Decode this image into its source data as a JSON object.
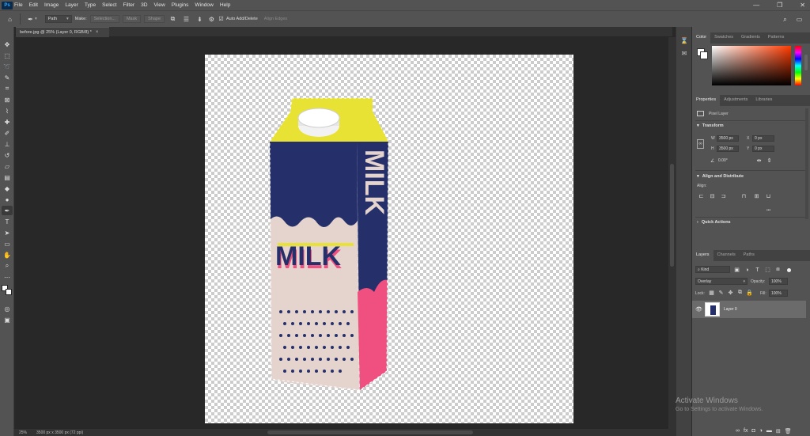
{
  "menubar": {
    "logo": "Ps",
    "menus": [
      "File",
      "Edit",
      "Image",
      "Layer",
      "Type",
      "Select",
      "Filter",
      "3D",
      "View",
      "Plugins",
      "Window",
      "Help"
    ],
    "window_controls": [
      "—",
      "❐",
      "✕"
    ]
  },
  "options": {
    "mode_value": "Path",
    "make_label": "Make:",
    "selection_btn": "Selection...",
    "mask_btn": "Mask",
    "shape_btn": "Shape",
    "auto_add_delete": "Auto Add/Delete",
    "align_edges": "Align Edges"
  },
  "document": {
    "tab_title": "before.jpg @ 25% (Layer 0, RGB/8) *",
    "close": "×"
  },
  "status": {
    "zoom": "25%",
    "doc_size": "3500 px x 3500 px (72 ppi)"
  },
  "artwork": {
    "brand_front": "MILK",
    "brand_side": "MILK"
  },
  "colors": {
    "ps_blue": "#31a8ff",
    "panel_bg": "#535353",
    "carton_blue": "#25306b",
    "carton_yellow": "#e8e234",
    "carton_pink": "#f0507f",
    "carton_cream": "#e5d3ce"
  },
  "color_panel": {
    "tabs": [
      "Color",
      "Swatches",
      "Gradients",
      "Patterns"
    ]
  },
  "properties_panel": {
    "tabs": [
      "Properties",
      "Adjustments",
      "Libraries"
    ],
    "layer_type": "Pixel Layer",
    "transform_title": "Transform",
    "w_label": "W",
    "w_value": "3500 px",
    "h_label": "H",
    "h_value": "3500 px",
    "x_label": "X",
    "x_value": "0 px",
    "y_label": "Y",
    "y_value": "0 px",
    "angle_value": "0.00°",
    "align_title": "Align and Distribute",
    "align_label": "Align:",
    "more": "•••",
    "quick_actions_title": "Quick Actions"
  },
  "layers_panel": {
    "tabs": [
      "Layers",
      "Channels",
      "Paths"
    ],
    "kind_label": "Kind",
    "blend_mode": "Overlay",
    "opacity_label": "Opacity:",
    "opacity_value": "100%",
    "lock_label": "Lock:",
    "fill_label": "Fill:",
    "fill_value": "100%",
    "layer_name": "Layer 0"
  },
  "watermark": {
    "line1": "Activate Windows",
    "line2": "Go to Settings to activate Windows."
  },
  "bottom_icons": [
    "link-icon",
    "fx-icon",
    "mask-icon",
    "adjust-icon",
    "folder-icon",
    "new-layer-icon",
    "trash-icon"
  ]
}
